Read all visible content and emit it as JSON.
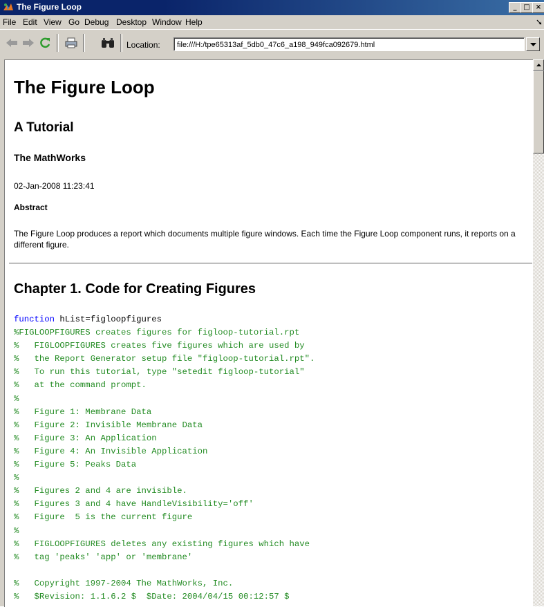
{
  "window": {
    "title": "The Figure Loop",
    "controls": [
      "_",
      "□",
      "×"
    ]
  },
  "menu": {
    "items": [
      "File",
      "Edit",
      "View",
      "Go",
      "Debug",
      "Desktop",
      "Window",
      "Help"
    ]
  },
  "toolbar": {
    "location_label": "Location:",
    "location_value": "file:///H:/tpe65313af_5db0_47c6_a198_949fca092679.html"
  },
  "document": {
    "title": "The Figure Loop",
    "subtitle": "A Tutorial",
    "author": "The MathWorks",
    "date": "02-Jan-2008 11:23:41",
    "abstract_heading": "Abstract",
    "abstract_text": "The Figure Loop produces a report which documents multiple figure windows. Each time the Figure Loop component runs, it reports on a different figure.",
    "chapter_title": "Chapter 1. Code for Creating Figures",
    "code": {
      "keyword": "function",
      "signature": " hList=figloopfigures",
      "comment_lines": [
        "%FIGLOOPFIGURES creates figures for figloop-tutorial.rpt",
        "%   FIGLOOPFIGURES creates five figures which are used by",
        "%   the Report Generator setup file \"figloop-tutorial.rpt\".",
        "%   To run this tutorial, type \"setedit figloop-tutorial\"",
        "%   at the command prompt.",
        "%",
        "%   Figure 1: Membrane Data",
        "%   Figure 2: Invisible Membrane Data",
        "%   Figure 3: An Application",
        "%   Figure 4: An Invisible Application",
        "%   Figure 5: Peaks Data",
        "%",
        "%   Figures 2 and 4 are invisible.",
        "%   Figures 3 and 4 have HandleVisibility='off'",
        "%   Figure  5 is the current figure",
        "%",
        "%   FIGLOOPFIGURES deletes any existing figures which have",
        "%   tag 'peaks' 'app' or 'membrane'",
        "",
        "%   Copyright 1997-2004 The MathWorks, Inc.",
        "%   $Revision: 1.1.6.2 $  $Date: 2004/04/15 00:12:57 $"
      ]
    }
  }
}
